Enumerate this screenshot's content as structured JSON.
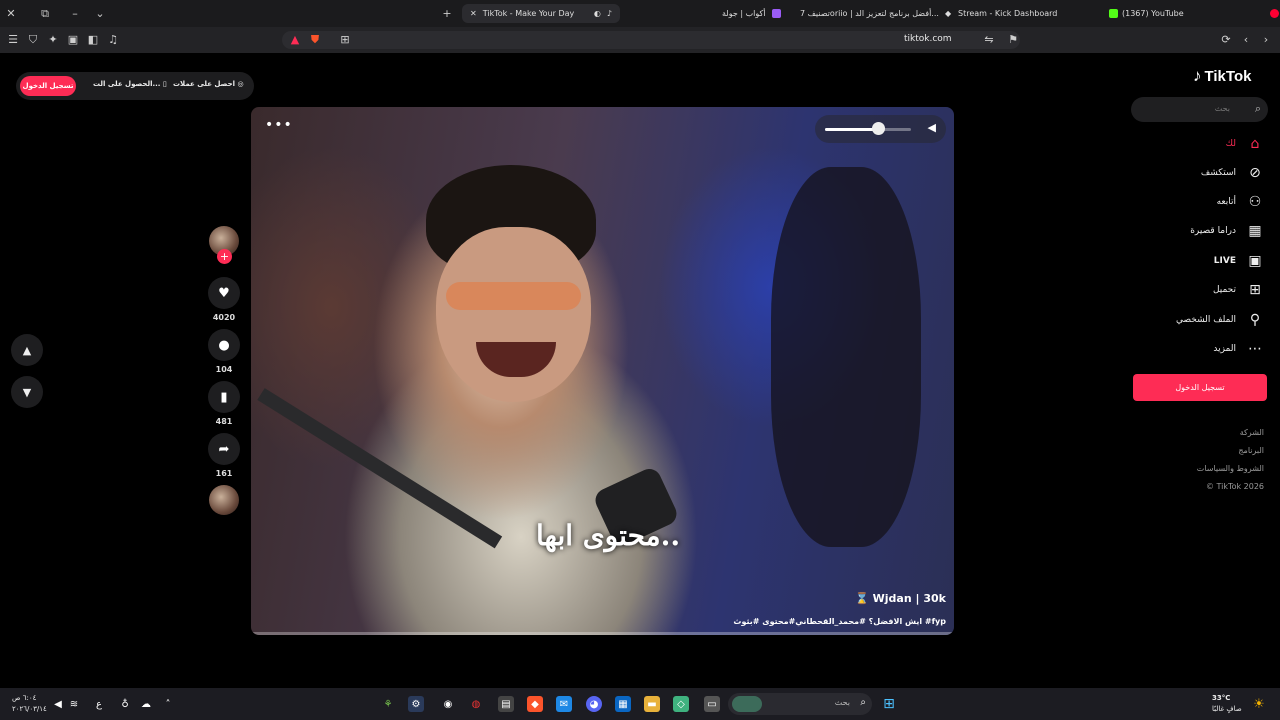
{
  "browser": {
    "tabs": [
      {
        "title": "TikTok - Make Your Day"
      },
      {
        "title": "أكواب | جولة"
      },
      {
        "title": "تصنيف 7oriio | أفضل برنامج لتعزيز الد..."
      },
      {
        "title": "Stream - Kick Dashboard"
      },
      {
        "title": "(1367) YouTube"
      }
    ],
    "url": "tiktok.com"
  },
  "top_bar": {
    "login_label": "تسجيل الدخول",
    "get_app_label": "الحصول على الت...",
    "get_coins_label": "احصل على عملات"
  },
  "sidebar": {
    "logo_text": "TikTok",
    "search_placeholder": "بحث",
    "items": [
      {
        "label": "لك",
        "icon": "home-icon"
      },
      {
        "label": "استكشف",
        "icon": "compass-icon"
      },
      {
        "label": "أتابعه",
        "icon": "following-icon"
      },
      {
        "label": "دراما قصيرة",
        "icon": "film-icon"
      },
      {
        "label": "LIVE",
        "icon": "live-icon"
      },
      {
        "label": "تحميل",
        "icon": "upload-icon"
      },
      {
        "label": "الملف الشخصي",
        "icon": "profile-icon"
      },
      {
        "label": "المزيد",
        "icon": "more-icon"
      }
    ],
    "login_button": "تسجيل الدخول",
    "footer": [
      "الشركة",
      "البرنامج",
      "الشروط والسياسات",
      "© TikTok 2026"
    ]
  },
  "video": {
    "caption_overlay": "محتوى ابها..",
    "author": "Wjdan | 30k",
    "description": "ايش الافضل؟ #محمد_القحطاني#محتوى #بثوث #fyp",
    "volume_level": 0.62
  },
  "actions": {
    "likes": "4020",
    "comments": "104",
    "saves": "481",
    "shares": "161"
  },
  "taskbar": {
    "search_placeholder": "بحث",
    "time": "٦:٠٤ ص",
    "date": "٢٠٢٦/٠٣/١٤",
    "weather_temp": "33°C",
    "weather_desc": "صافٍ غالبًا",
    "lang": "ع"
  },
  "colors": {
    "accent": "#fe2c55",
    "background": "#000000",
    "sidebar_hover": "#1e1e20"
  }
}
